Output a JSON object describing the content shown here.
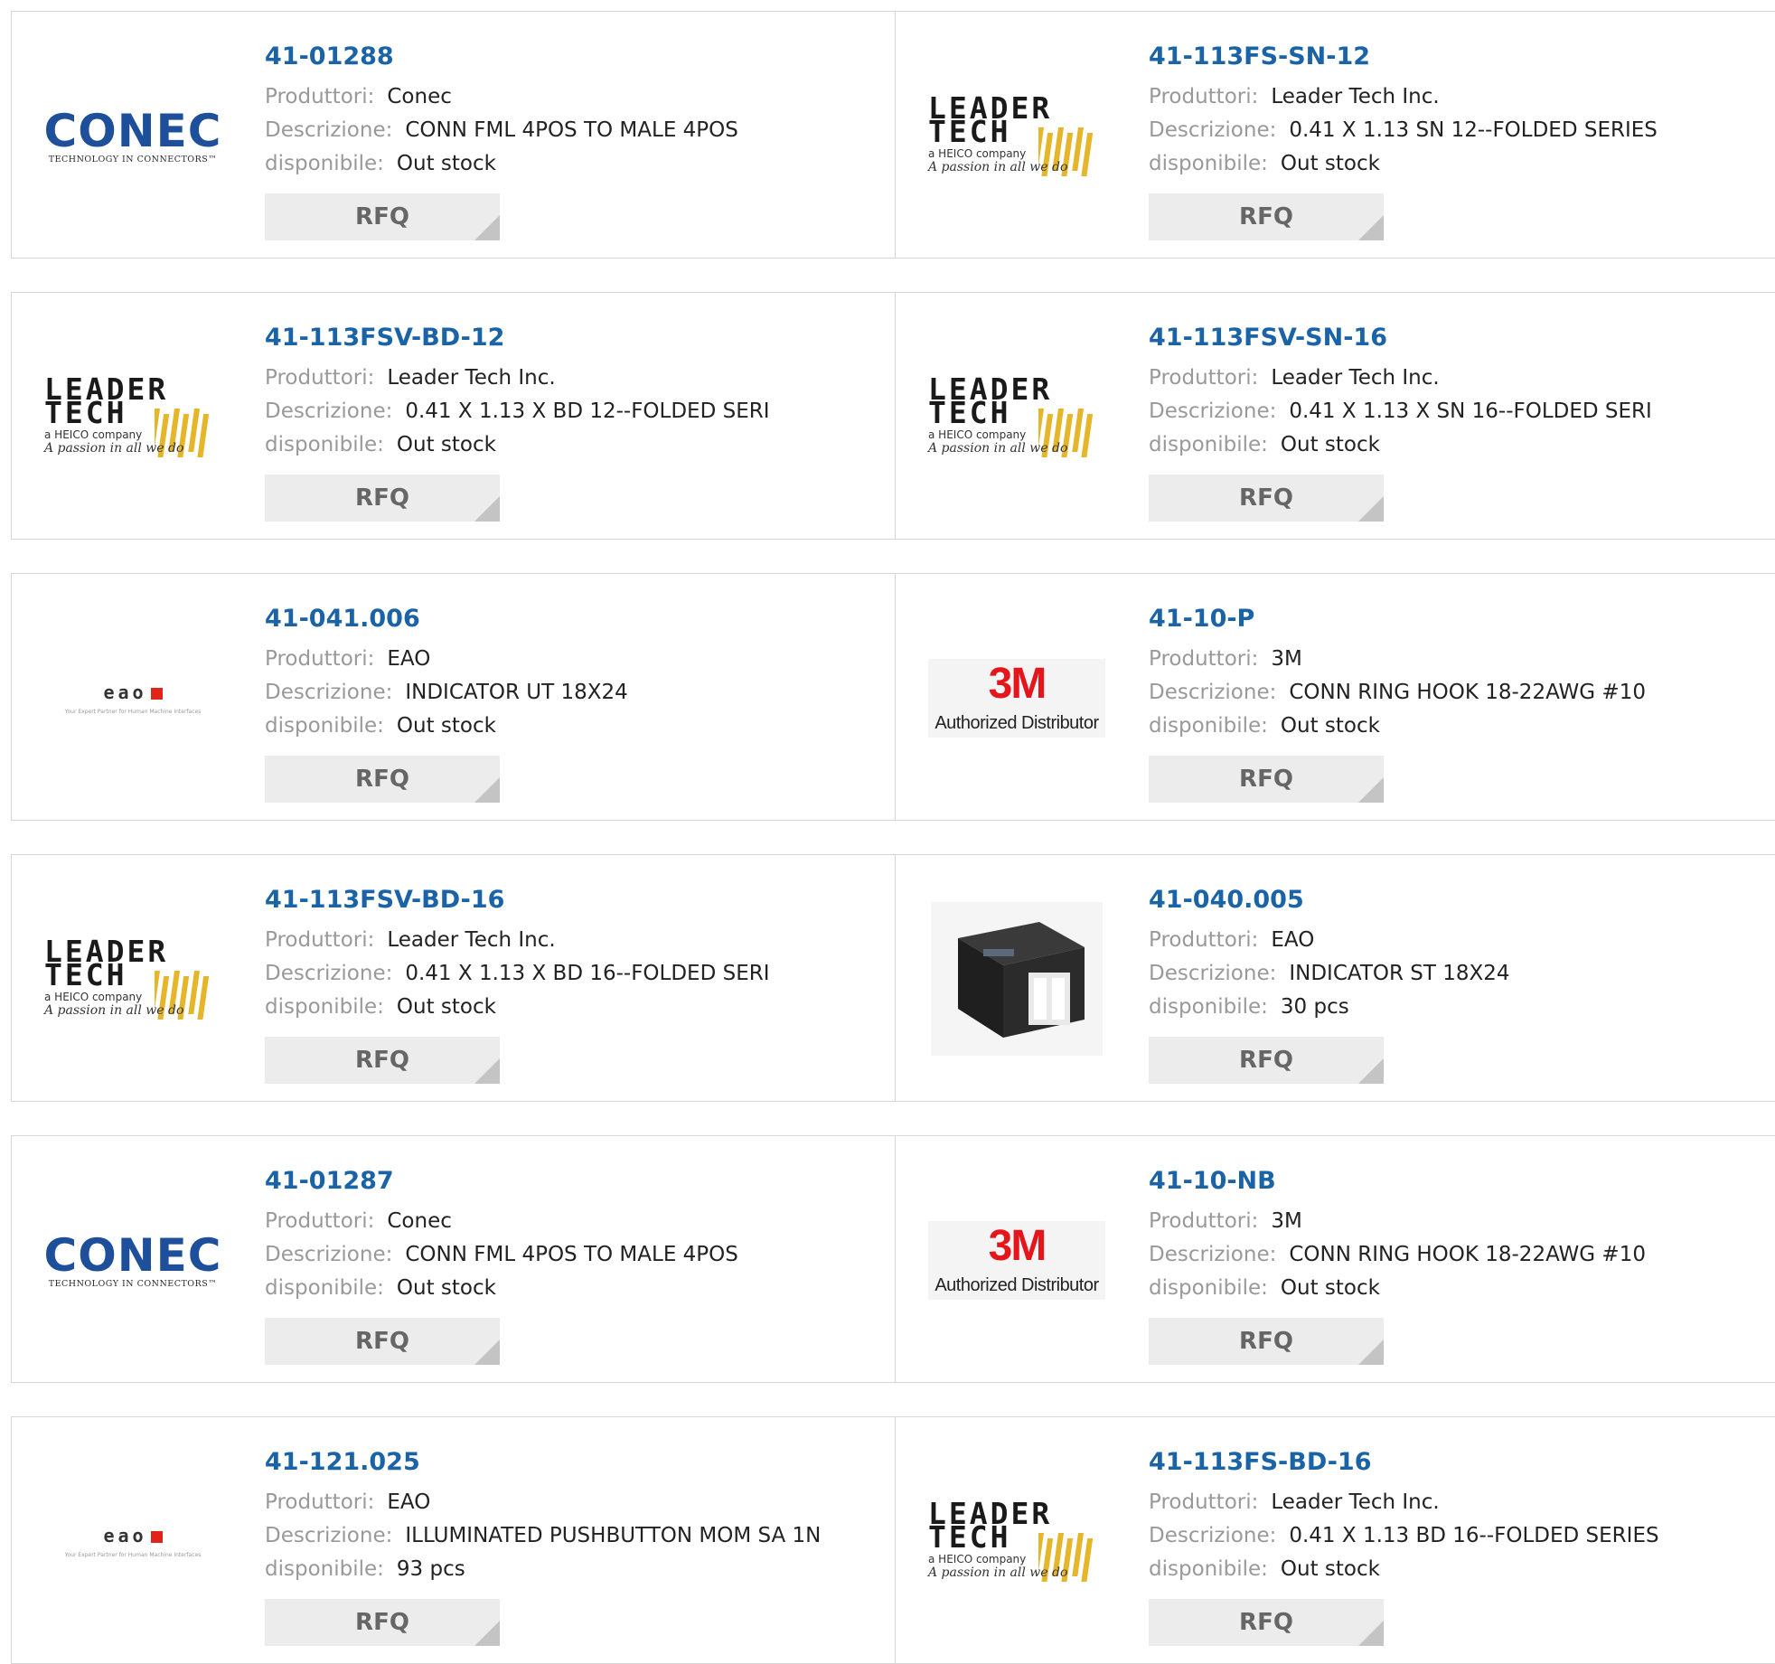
{
  "labels": {
    "manufacturer": "Produttori:",
    "description": "Descrizione:",
    "availability": "disponibile:",
    "rfq": "RFQ"
  },
  "products": [
    {
      "part": "41-01288",
      "manufacturer": "Conec",
      "description": "CONN FML 4POS TO MALE 4POS",
      "availability": "Out stock",
      "logo": "conec"
    },
    {
      "part": "41-113FS-SN-12",
      "manufacturer": "Leader Tech Inc.",
      "description": "0.41 X 1.13 SN 12--FOLDED SERIES",
      "availability": "Out stock",
      "logo": "leadertech"
    },
    {
      "part": "41-113FSV-BD-12",
      "manufacturer": "Leader Tech Inc.",
      "description": "0.41 X 1.13 X BD 12--FOLDED SERI",
      "availability": "Out stock",
      "logo": "leadertech"
    },
    {
      "part": "41-113FSV-SN-16",
      "manufacturer": "Leader Tech Inc.",
      "description": "0.41 X 1.13 X SN 16--FOLDED SERI",
      "availability": "Out stock",
      "logo": "leadertech"
    },
    {
      "part": "41-041.006",
      "manufacturer": "EAO",
      "description": "INDICATOR UT 18X24",
      "availability": "Out stock",
      "logo": "eao"
    },
    {
      "part": "41-10-P",
      "manufacturer": "3M",
      "description": "CONN RING HOOK 18-22AWG #10",
      "availability": "Out stock",
      "logo": "3m"
    },
    {
      "part": "41-113FSV-BD-16",
      "manufacturer": "Leader Tech Inc.",
      "description": "0.41 X 1.13 X BD 16--FOLDED SERI",
      "availability": "Out stock",
      "logo": "leadertech"
    },
    {
      "part": "41-040.005",
      "manufacturer": "EAO",
      "description": "INDICATOR ST 18X24",
      "availability": "30 pcs",
      "logo": "product-photo"
    },
    {
      "part": "41-01287",
      "manufacturer": "Conec",
      "description": "CONN FML 4POS TO MALE 4POS",
      "availability": "Out stock",
      "logo": "conec"
    },
    {
      "part": "41-10-NB",
      "manufacturer": "3M",
      "description": "CONN RING HOOK 18-22AWG #10",
      "availability": "Out stock",
      "logo": "3m"
    },
    {
      "part": "41-121.025",
      "manufacturer": "EAO",
      "description": "ILLUMINATED PUSHBUTTON MOM SA 1N",
      "availability": "93 pcs",
      "logo": "eao"
    },
    {
      "part": "41-113FS-BD-16",
      "manufacturer": "Leader Tech Inc.",
      "description": "0.41 X 1.13 BD 16--FOLDED SERIES",
      "availability": "Out stock",
      "logo": "leadertech"
    }
  ],
  "logos": {
    "conec": {
      "word": "CONEC",
      "tagline": "TECHNOLOGY IN CONNECTORS™",
      "color": "#1e4f9a"
    },
    "leadertech": {
      "line1": "LEADER",
      "line2": "TECH",
      "sub": "a HEICO company",
      "script": "A passion in all we do",
      "bar_color": "#e5b52a"
    },
    "eao": {
      "word": "eao",
      "tagline": "Your Expert Partner for Human Machine Interfaces",
      "square_color": "#e2231a"
    },
    "3m": {
      "word": "3M",
      "tagline": "Authorized Distributor",
      "color": "#e4151b"
    }
  },
  "colors": {
    "part_link": "#1a63a6",
    "label": "#999999",
    "value": "#222222",
    "rfq_bg": "#ececec",
    "border": "#d6d6d6"
  }
}
